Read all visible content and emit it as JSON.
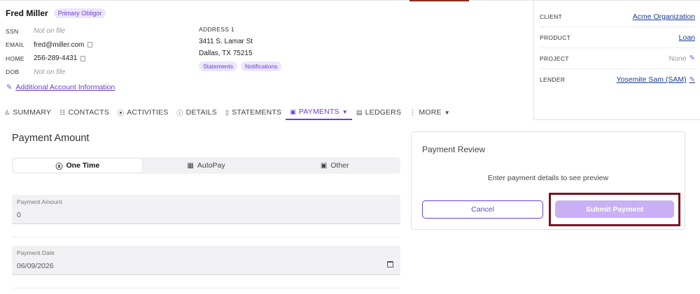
{
  "obligor": {
    "name": "Fred Miller",
    "role_badge": "Primary Obligor",
    "ssn_label": "SSN",
    "ssn_value": "Not on file",
    "email_label": "EMAIL",
    "email_value": "fred@miller.com",
    "home_label": "HOME",
    "home_value": "256-289-4431",
    "dob_label": "DOB",
    "dob_value": "Not on file"
  },
  "address": {
    "label": "ADDRESS 1",
    "line1": "3411 S. Lamar St",
    "line2": "Dallas, TX 75215",
    "tags": [
      "Statements",
      "Notifications"
    ]
  },
  "additional_link": "Additional Account Information",
  "account_info": {
    "client_label": "CLIENT",
    "client_value": "Acme Organization",
    "product_label": "PRODUCT",
    "product_value": "Loan",
    "project_label": "PROJECT",
    "project_value": "None",
    "lender_label": "LENDER",
    "lender_value": "Yosemite Sam (SAM)"
  },
  "tabs": [
    {
      "label": "SUMMARY",
      "icon": "user-icon"
    },
    {
      "label": "CONTACTS",
      "icon": "contacts-icon"
    },
    {
      "label": "ACTIVITIES",
      "icon": "broadcast-icon"
    },
    {
      "label": "DETAILS",
      "icon": "info-icon"
    },
    {
      "label": "STATEMENTS",
      "icon": "document-icon"
    },
    {
      "label": "PAYMENTS",
      "icon": "cash-icon",
      "active": true
    },
    {
      "label": "LEDGERS",
      "icon": "ledger-icon"
    },
    {
      "label": "MORE",
      "icon": "more-vertical-icon"
    }
  ],
  "payment": {
    "title": "Payment Amount",
    "segments": [
      "One Time",
      "AutoPay",
      "Other"
    ],
    "amount_label": "Payment Amount",
    "amount_value": "0",
    "date_label": "Payment Date",
    "date_value": "06/09/2026"
  },
  "review": {
    "title": "Payment Review",
    "hint": "Enter payment details to see preview",
    "cancel_label": "Cancel",
    "submit_label": "Submit Payment"
  },
  "colors": {
    "accent": "#6b3fd6",
    "submit_disabled": "#c9b0f5",
    "highlight_box": "#7a1426"
  }
}
